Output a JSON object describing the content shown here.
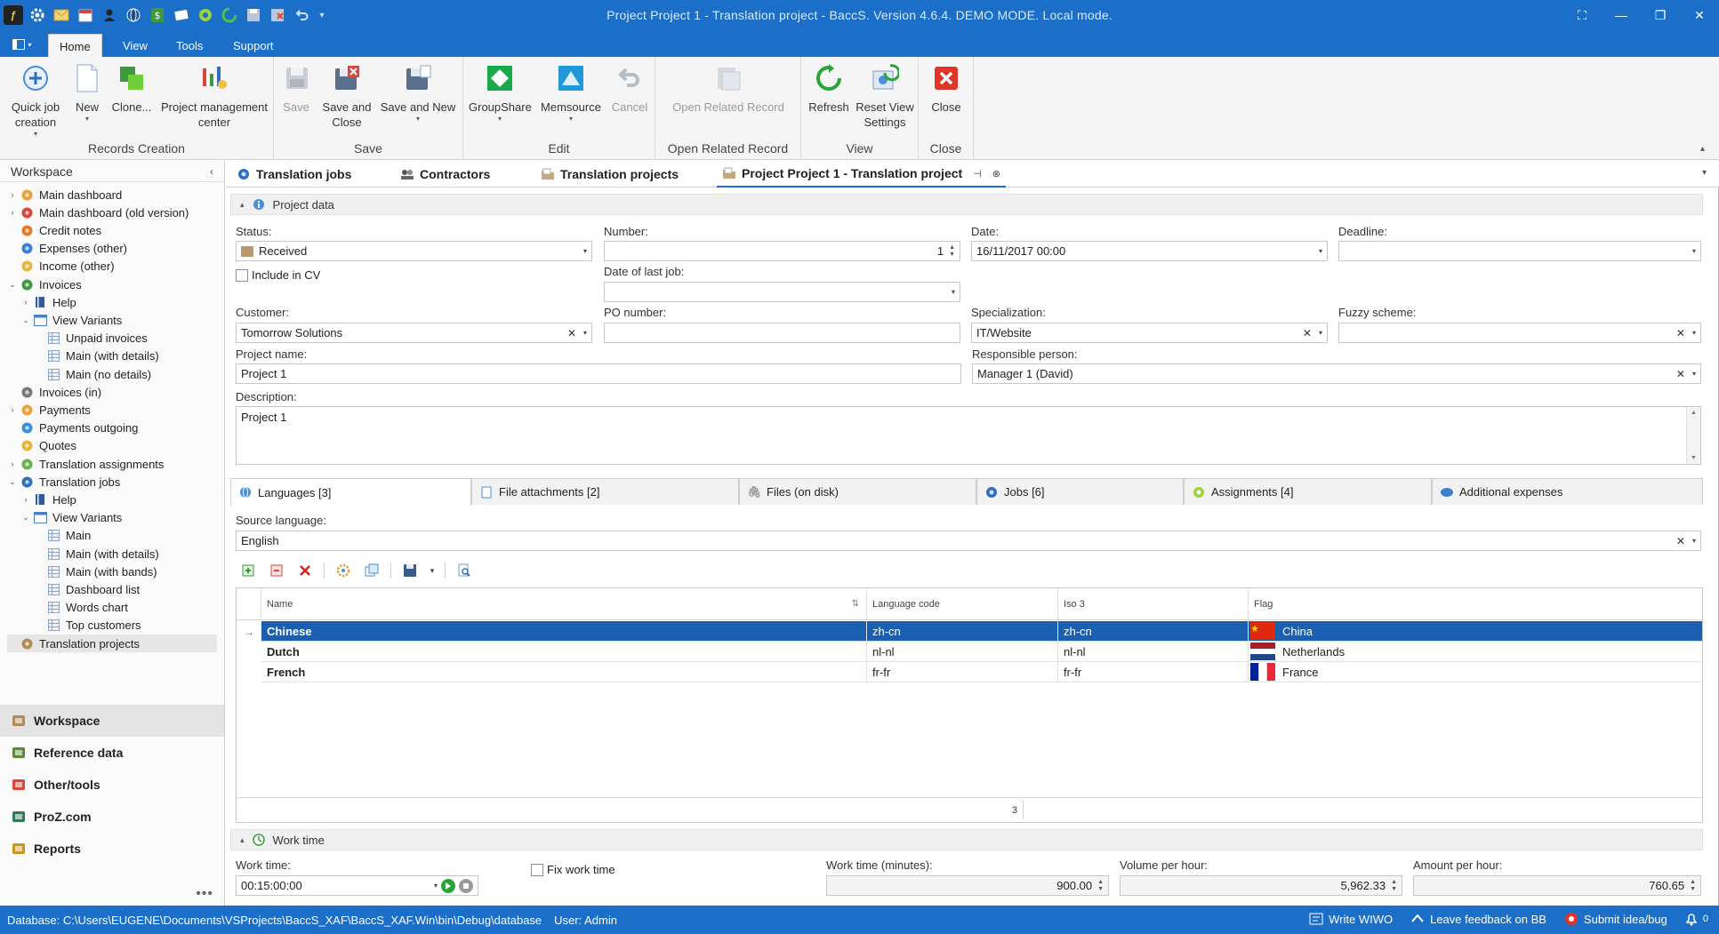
{
  "window": {
    "title": "Project Project 1 - Translation project - BaccS. Version 4.6.4. DEMO MODE. Local mode.",
    "controls": [
      "⛶",
      "—",
      "❐",
      "✕"
    ]
  },
  "ribbon_tabs": [
    "Home",
    "View",
    "Tools",
    "Support"
  ],
  "ribbon": {
    "records_creation": {
      "label": "Records Creation",
      "quick_job": "Quick job creation",
      "new": "New",
      "clone": "Clone...",
      "pmc": "Project management center"
    },
    "save_group": {
      "label": "Save",
      "save": "Save",
      "save_close": "Save and Close",
      "save_new": "Save and New"
    },
    "edit_group": {
      "label": "Edit",
      "groupshare": "GroupShare",
      "memsource": "Memsource",
      "cancel": "Cancel"
    },
    "open_related": {
      "label": "Open Related Record",
      "button": "Open Related Record"
    },
    "view_group": {
      "label": "View",
      "refresh": "Refresh",
      "reset": "Reset View Settings"
    },
    "close_group": {
      "label": "Close",
      "close": "Close"
    }
  },
  "workspace": {
    "title": "Workspace",
    "tree": [
      {
        "label": "Main dashboard",
        "level": 0,
        "expander": "right",
        "icon": "dashboard-icon",
        "color": "#e8a33a"
      },
      {
        "label": "Main dashboard (old version)",
        "level": 0,
        "expander": "right",
        "icon": "dashboard-old-icon",
        "color": "#d9463c"
      },
      {
        "label": "Credit notes",
        "level": 0,
        "expander": "",
        "icon": "credit-notes-icon",
        "color": "#e07b2a"
      },
      {
        "label": "Expenses (other)",
        "level": 0,
        "expander": "",
        "icon": "expenses-icon",
        "color": "#3a7fd0"
      },
      {
        "label": "Income (other)",
        "level": 0,
        "expander": "",
        "icon": "income-icon",
        "color": "#e8b63a"
      },
      {
        "label": "Invoices",
        "level": 0,
        "expander": "down",
        "icon": "invoices-icon",
        "color": "#3c9a3c"
      },
      {
        "label": "Help",
        "level": 1,
        "expander": "right",
        "icon": "help-book-icon",
        "color": "#2f5aa8"
      },
      {
        "label": "View Variants",
        "level": 1,
        "expander": "down",
        "icon": "view-variants-icon",
        "color": "#4a7fc8"
      },
      {
        "label": "Unpaid invoices",
        "level": 2,
        "expander": "",
        "icon": "grid-view-icon",
        "color": "#8da4c3"
      },
      {
        "label": "Main (with details)",
        "level": 2,
        "expander": "",
        "icon": "grid-view-icon",
        "color": "#8da4c3"
      },
      {
        "label": "Main (no details)",
        "level": 2,
        "expander": "",
        "icon": "grid-view-icon",
        "color": "#8da4c3"
      },
      {
        "label": "Invoices (in)",
        "level": 0,
        "expander": "",
        "icon": "invoices-in-icon",
        "color": "#7a7a7a"
      },
      {
        "label": "Payments",
        "level": 0,
        "expander": "right",
        "icon": "payments-icon",
        "color": "#e8a33a"
      },
      {
        "label": "Payments outgoing",
        "level": 0,
        "expander": "",
        "icon": "payments-outgoing-icon",
        "color": "#3a8fd8"
      },
      {
        "label": "Quotes",
        "level": 0,
        "expander": "",
        "icon": "quotes-icon",
        "color": "#e8b63a"
      },
      {
        "label": "Translation assignments",
        "level": 0,
        "expander": "right",
        "icon": "assignments-icon",
        "color": "#6ab04c"
      },
      {
        "label": "Translation jobs",
        "level": 0,
        "expander": "down",
        "icon": "translation-jobs-icon",
        "color": "#2f6fc0"
      },
      {
        "label": "Help",
        "level": 1,
        "expander": "right",
        "icon": "help-book-icon",
        "color": "#2f5aa8"
      },
      {
        "label": "View Variants",
        "level": 1,
        "expander": "down",
        "icon": "view-variants-icon",
        "color": "#4a7fc8"
      },
      {
        "label": "Main",
        "level": 2,
        "expander": "",
        "icon": "grid-view-icon",
        "color": "#8da4c3"
      },
      {
        "label": "Main (with details)",
        "level": 2,
        "expander": "",
        "icon": "grid-view-icon",
        "color": "#8da4c3"
      },
      {
        "label": "Main (with bands)",
        "level": 2,
        "expander": "",
        "icon": "grid-view-icon",
        "color": "#8da4c3"
      },
      {
        "label": "Dashboard list",
        "level": 2,
        "expander": "",
        "icon": "grid-view-icon",
        "color": "#8da4c3"
      },
      {
        "label": "Words chart",
        "level": 2,
        "expander": "",
        "icon": "grid-view-icon",
        "color": "#8da4c3"
      },
      {
        "label": "Top customers",
        "level": 2,
        "expander": "",
        "icon": "grid-view-icon",
        "color": "#8da4c3"
      },
      {
        "label": "Translation projects",
        "level": 0,
        "expander": "",
        "icon": "translation-projects-icon",
        "color": "#b08a5a",
        "selected": true
      }
    ],
    "nav": [
      {
        "label": "Workspace",
        "icon": "workspace-icon",
        "color": "#b08a5a",
        "active": true
      },
      {
        "label": "Reference data",
        "icon": "reference-data-icon",
        "color": "#5a8a3a"
      },
      {
        "label": "Other/tools",
        "icon": "tools-icon",
        "color": "#d9463c"
      },
      {
        "label": "ProZ.com",
        "icon": "proz-icon",
        "color": "#2f7a5a"
      },
      {
        "label": "Reports",
        "icon": "reports-icon",
        "color": "#c8961e"
      }
    ]
  },
  "doc_tabs": [
    {
      "label": "Translation jobs",
      "icon": "translation-jobs-icon"
    },
    {
      "label": "Contractors",
      "icon": "contractors-icon"
    },
    {
      "label": "Translation projects",
      "icon": "translation-projects-icon"
    },
    {
      "label": "Project Project 1 - Translation project",
      "icon": "translation-projects-icon",
      "active": true
    }
  ],
  "project_data": {
    "header": "Project data",
    "status_label": "Status:",
    "status": "Received",
    "include_cv": "Include in CV",
    "number_label": "Number:",
    "number": "1",
    "date_label": "Date:",
    "date": "16/11/2017 00:00",
    "deadline_label": "Deadline:",
    "deadline": "",
    "last_job_label": "Date of last job:",
    "last_job": "",
    "customer_label": "Customer:",
    "customer": "Tomorrow Solutions",
    "po_label": "PO number:",
    "po": "",
    "specialization_label": "Specialization:",
    "specialization": "IT/Website",
    "fuzzy_label": "Fuzzy scheme:",
    "fuzzy": "",
    "name_label": "Project name:",
    "name": "Project 1",
    "responsible_label": "Responsible person:",
    "responsible": "Manager 1 (David)",
    "description_label": "Description:",
    "description": "Project 1"
  },
  "inner_tabs": [
    {
      "label": "Languages [3]",
      "active": true,
      "icon": "languages-icon"
    },
    {
      "label": "File attachments [2]",
      "icon": "attachment-icon"
    },
    {
      "label": "Files (on disk)",
      "icon": "files-disk-icon"
    },
    {
      "label": "Jobs [6]",
      "icon": "jobs-icon"
    },
    {
      "label": "Assignments [4]",
      "icon": "assignments-icon"
    },
    {
      "label": "Additional expenses",
      "icon": "expenses-icon"
    }
  ],
  "languages": {
    "source_label": "Source language:",
    "source": "English",
    "columns": [
      "Name",
      "Language code",
      "Iso 3",
      "Flag"
    ],
    "rows": [
      {
        "name": "Chinese",
        "code": "zh-cn",
        "iso3": "zh-cn",
        "flag": "China",
        "selected": true
      },
      {
        "name": "Dutch",
        "code": "nl-nl",
        "iso3": "nl-nl",
        "flag": "Netherlands"
      },
      {
        "name": "French",
        "code": "fr-fr",
        "iso3": "fr-fr",
        "flag": "France"
      }
    ],
    "count": "3"
  },
  "work_time": {
    "header": "Work time",
    "work_time_label": "Work time:",
    "work_time": "00:15:00:00",
    "fix_label": "Fix work time",
    "minutes_label": "Work time (minutes):",
    "minutes": "900.00",
    "volume_label": "Volume per hour:",
    "volume": "5,962.33",
    "amount_label": "Amount per hour:",
    "amount": "760.65"
  },
  "status_bar": {
    "database": "Database: C:\\Users\\EUGENE\\Documents\\VSProjects\\BaccS_XAF\\BaccS_XAF.Win\\bin\\Debug\\database",
    "user": "User: Admin",
    "write": "Write WIWO",
    "feedback": "Leave feedback on BB",
    "submit": "Submit idea/bug"
  }
}
